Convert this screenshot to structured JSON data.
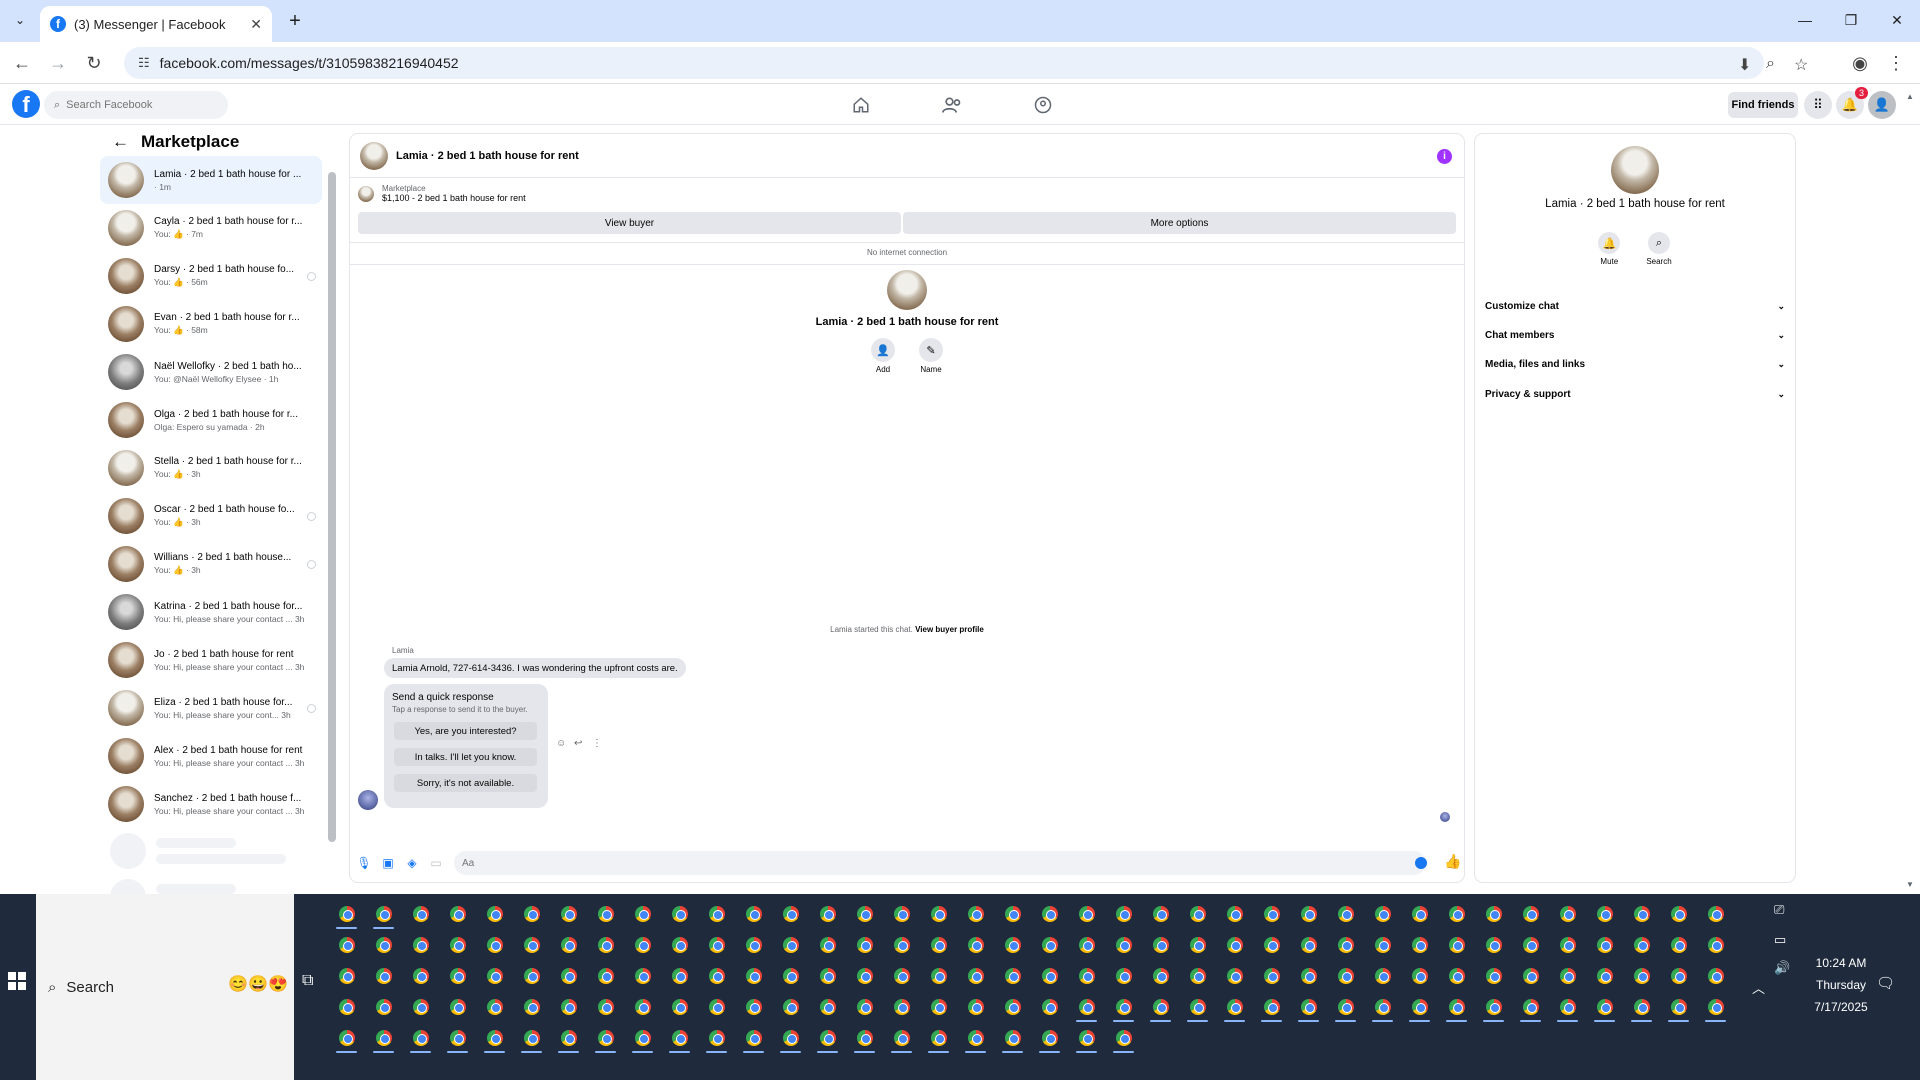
{
  "browser": {
    "tab_title": "(3) Messenger | Facebook",
    "url": "facebook.com/messages/t/31059838216940452"
  },
  "fb": {
    "search_placeholder": "Search Facebook",
    "find_friends": "Find friends",
    "notification_count": "3"
  },
  "sidebar": {
    "title": "Marketplace",
    "conversations": [
      {
        "name": "Lamia · 2 bed 1 bath house for ...",
        "sub": "· 1m"
      },
      {
        "name": "Cayla · 2 bed 1 bath house for r...",
        "sub": "You: 👍 · 7m"
      },
      {
        "name": "Darsy · 2 bed 1 bath house fo...",
        "sub": "You: 👍 · 56m"
      },
      {
        "name": "Evan · 2 bed 1 bath house for r...",
        "sub": "You: 👍 · 58m"
      },
      {
        "name": "Naël Wellofky · 2 bed 1 bath ho...",
        "sub": "You: @Naël Wellofky Elysee · 1h"
      },
      {
        "name": "Olga · 2 bed 1 bath house for r...",
        "sub": "Olga: Espero su yamada · 2h"
      },
      {
        "name": "Stella · 2 bed 1 bath house for r...",
        "sub": "You: 👍 · 3h"
      },
      {
        "name": "Oscar · 2 bed 1 bath house fo...",
        "sub": "You: 👍 · 3h"
      },
      {
        "name": "Willians · 2 bed 1 bath house...",
        "sub": "You: 👍 · 3h"
      },
      {
        "name": "Katrina · 2 bed 1 bath house for...",
        "sub": "You: Hi, please share your contact ... 3h"
      },
      {
        "name": "Jo · 2 bed 1 bath house for rent",
        "sub": "You: Hi, please share your contact ... 3h"
      },
      {
        "name": "Eliza · 2 bed 1 bath house for...",
        "sub": "You: Hi, please share your cont... 3h"
      },
      {
        "name": "Alex · 2 bed 1 bath house for rent",
        "sub": "You: Hi, please share your contact ... 3h"
      },
      {
        "name": "Sanchez · 2 bed 1 bath house f...",
        "sub": "You: Hi, please share your contact ... 3h"
      }
    ]
  },
  "chat": {
    "title": "Lamia · 2 bed 1 bath house for rent",
    "marketplace_label": "Marketplace",
    "listing": "$1,100 - 2 bed 1 bath house for rent",
    "view_buyer": "View buyer",
    "more_options": "More options",
    "no_internet": "No internet connection",
    "profile_name": "Lamia · 2 bed 1 bath house for rent",
    "add_label": "Add",
    "name_label": "Name",
    "started_text": "Lamia started this chat.",
    "view_buyer_profile": "View buyer profile",
    "sender": "Lamia",
    "message": "Lamia Arnold, 727-614-3436. I was wondering the upfront costs are.",
    "quick_title": "Send a quick response",
    "quick_sub": "Tap a response to send it to the buyer.",
    "quick_replies": [
      "Yes, are you interested?",
      "In talks. I'll let you know.",
      "Sorry, it's not available."
    ],
    "composer_placeholder": "Aa"
  },
  "details": {
    "name": "Lamia · 2 bed 1 bath house for rent",
    "mute": "Mute",
    "search": "Search",
    "sections": [
      "Customize chat",
      "Chat members",
      "Media, files and links",
      "Privacy & support"
    ]
  },
  "taskbar": {
    "search_label": "Search",
    "time": "10:24 AM",
    "day": "Thursday",
    "date": "7/17/2025"
  }
}
